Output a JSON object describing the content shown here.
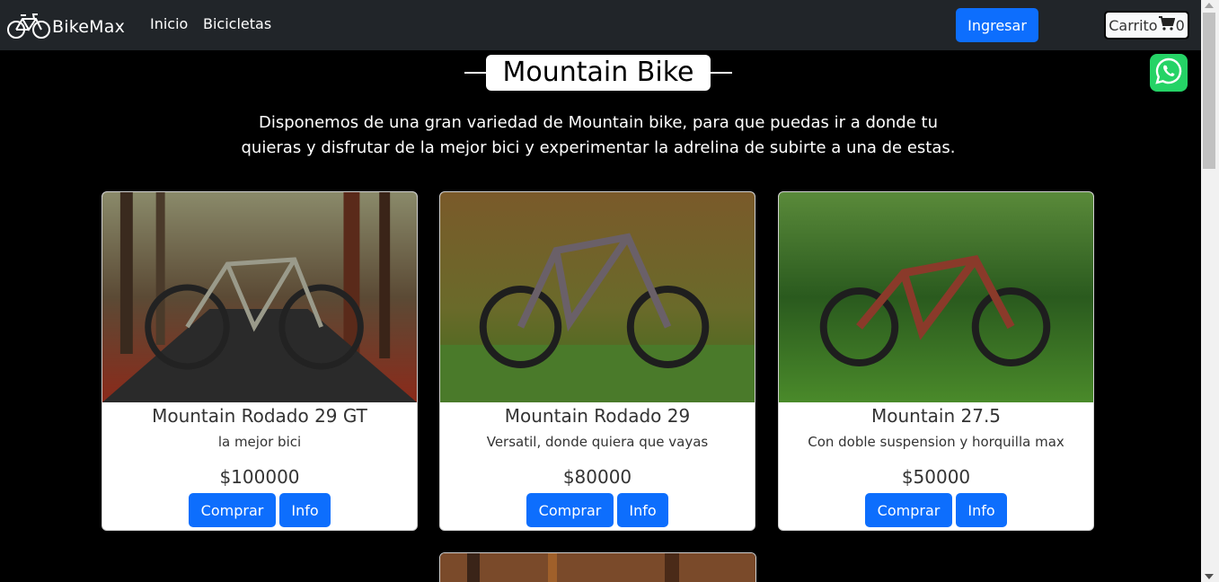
{
  "nav": {
    "brand": "BikeMax",
    "links": [
      "Inicio",
      "Bicicletas"
    ],
    "login_label": "Ingresar",
    "cart_label": "Carrito",
    "cart_count": "0"
  },
  "heading": "Mountain Bike",
  "intro": "Disponemos de una gran variedad de Mountain bike, para que puedas ir a donde tu quieras y disfrutar de la mejor bici y experimentar la adrelina de subirte a una de estas.",
  "products": [
    {
      "title": "Mountain Rodado 29 GT",
      "description": "la mejor bici",
      "price": "$100000",
      "buy_label": "Comprar",
      "info_label": "Info"
    },
    {
      "title": "Mountain Rodado 29",
      "description": "Versatil, donde quiera que vayas",
      "price": "$80000",
      "buy_label": "Comprar",
      "info_label": "Info"
    },
    {
      "title": "Mountain 27.5",
      "description": "Con doble suspension y horquilla max",
      "price": "$50000",
      "buy_label": "Comprar",
      "info_label": "Info"
    }
  ],
  "colors": {
    "navbar": "#212529",
    "primary": "#0d6efd",
    "whatsapp": "#25d366",
    "background": "#000000"
  },
  "icons": {
    "brand": "bicycle-icon",
    "cart": "cart-icon",
    "whatsapp": "whatsapp-icon"
  }
}
